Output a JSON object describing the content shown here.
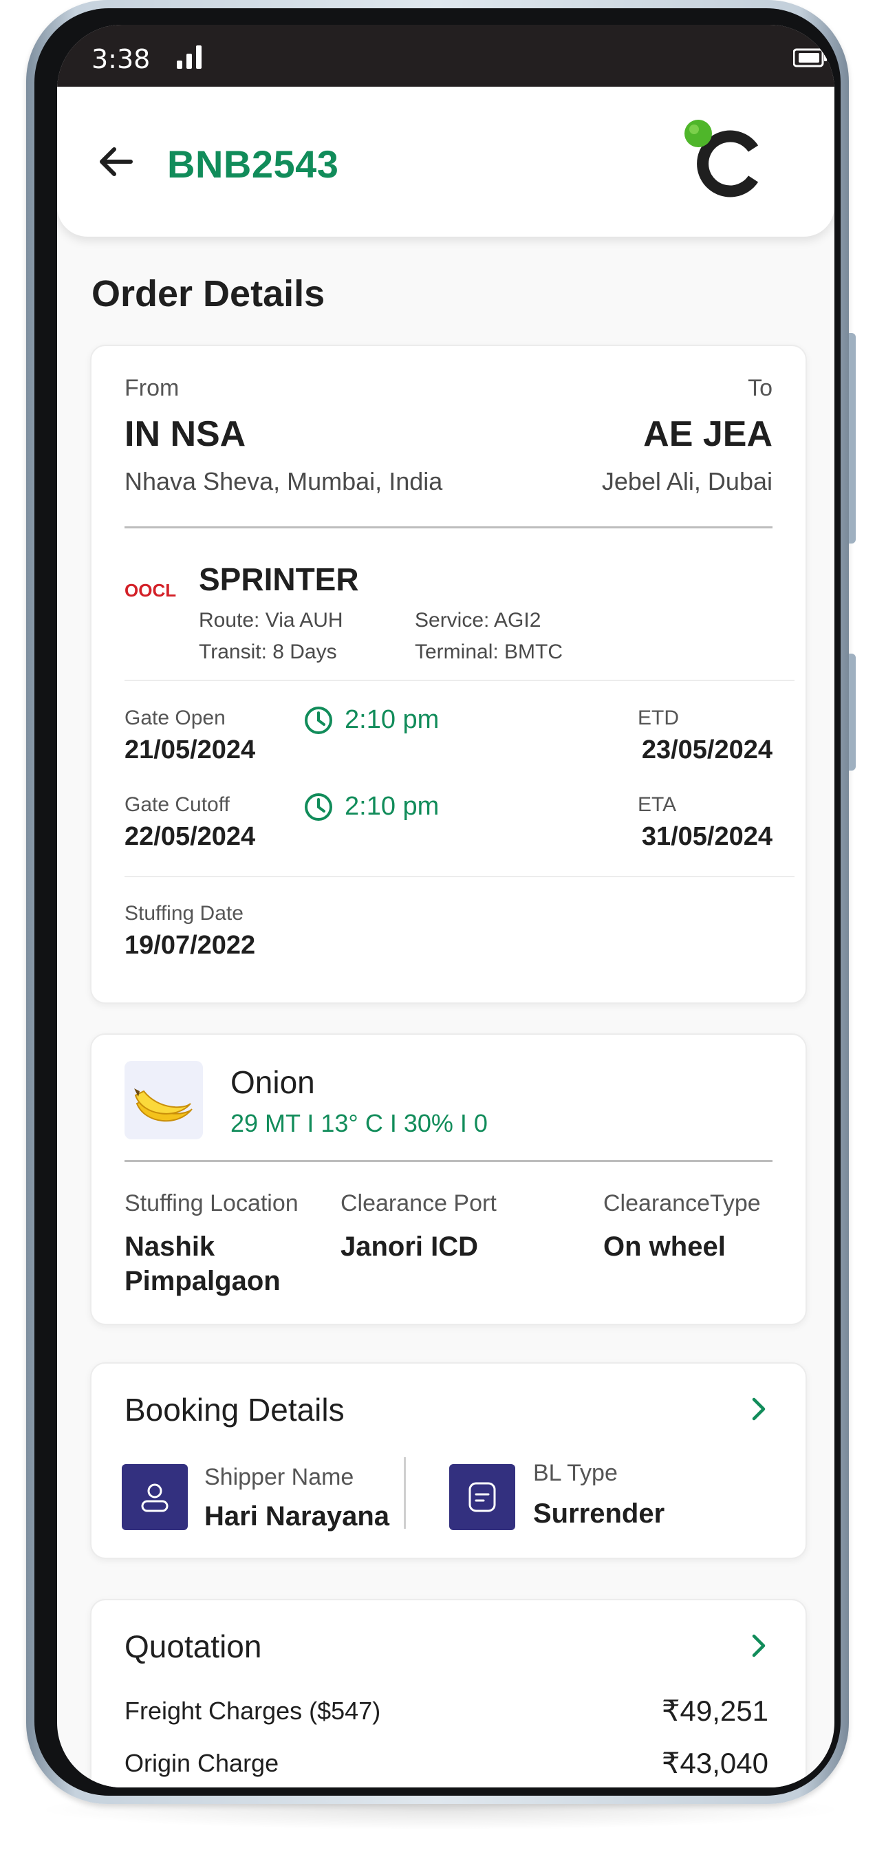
{
  "status_bar": {
    "time": "3:38"
  },
  "header": {
    "booking_id": "BNB2543"
  },
  "page": {
    "title": "Order Details"
  },
  "route": {
    "from_label": "From",
    "from_code": "IN NSA",
    "from_place": "Nhava Sheva, Mumbai, India",
    "to_label": "To",
    "to_code": "AE JEA",
    "to_place": "Jebel Ali, Dubai"
  },
  "carrier": {
    "logo_text": "OOCL",
    "vessel": "SPRINTER",
    "route": "Route: Via AUH",
    "transit": "Transit: 8 Days",
    "service": "Service: AGI2",
    "terminal": "Terminal: BMTC"
  },
  "schedule": {
    "gate_open_label": "Gate Open",
    "gate_open_date": "21/05/2024",
    "gate_open_time": "2:10 pm",
    "etd_label": "ETD",
    "etd_date": "23/05/2024",
    "gate_cutoff_label": "Gate Cutoff",
    "gate_cutoff_date": "22/05/2024",
    "gate_cutoff_time": "2:10 pm",
    "eta_label": "ETA",
    "eta_date": "31/05/2024",
    "stuffing_label": "Stuffing Date",
    "stuffing_date": "19/07/2022"
  },
  "product": {
    "name": "Onion",
    "specs": "29 MT I 13° C  I 30% I 0",
    "stuffing_location_label": "Stuffing Location",
    "stuffing_location_line1": "Nashik",
    "stuffing_location_line2": "Pimpalgaon",
    "clearance_port_label": "Clearance Port",
    "clearance_port": "Janori ICD",
    "clearance_type_label": "ClearanceType",
    "clearance_type": "On wheel"
  },
  "booking": {
    "title": "Booking Details",
    "shipper_label": "Shipper Name",
    "shipper_name": "Hari Narayana",
    "bl_type_label": "BL Type",
    "bl_type": "Surrender"
  },
  "quotation": {
    "title": "Quotation",
    "rows": [
      {
        "label": "Freight Charges ($547)",
        "amount": "₹49,251"
      },
      {
        "label": "Origin Charge",
        "amount": "₹43,040"
      }
    ]
  },
  "colors": {
    "accent_green": "#118c5a",
    "tile_indigo": "#33307f",
    "status_bar": "#231f20"
  }
}
